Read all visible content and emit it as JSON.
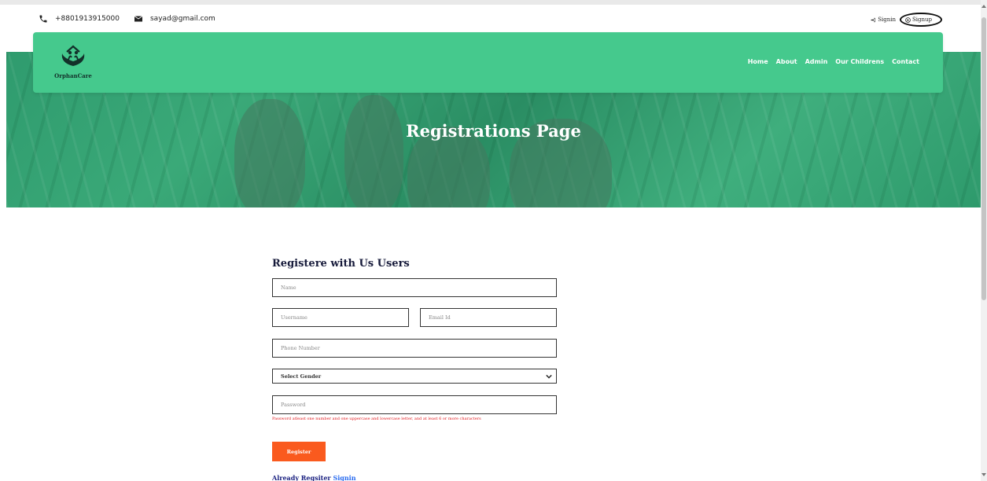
{
  "topbar": {
    "phone": "+8801913915000",
    "email": "sayad@gmail.com",
    "signin": "Signin",
    "signup": "Signup"
  },
  "navbar": {
    "brand": "OrphanCare",
    "menu": [
      "Home",
      "About",
      "Admin",
      "Our Childrens",
      "Contact"
    ]
  },
  "hero": {
    "title": "Registrations Page"
  },
  "form": {
    "heading": "Registere with Us Users",
    "name_placeholder": "Name",
    "username_placeholder": "Username",
    "email_placeholder": "Email Id",
    "phone_placeholder": "Phone Number",
    "gender_selected": "Select Gender",
    "password_placeholder": "Password",
    "password_hint": "Password atleast one number and one uppercase and lowercase letter, and at least 6 or more characters",
    "register_label": "Register",
    "already_text": "Already Regsiter",
    "signin_link": "Signin"
  },
  "colors": {
    "navbar": "#45c98d",
    "hero_overlay": "#2f9b6e",
    "register_button": "#fa5a1e",
    "hint_text": "#e0161b",
    "heading": "#161a3a"
  },
  "icons": {
    "phone": "phone-icon",
    "email": "envelope-icon",
    "signin": "sign-in-icon",
    "signup": "register-icon",
    "gender_select": "chevron-down-icon",
    "logo": "orphancare-logo"
  }
}
